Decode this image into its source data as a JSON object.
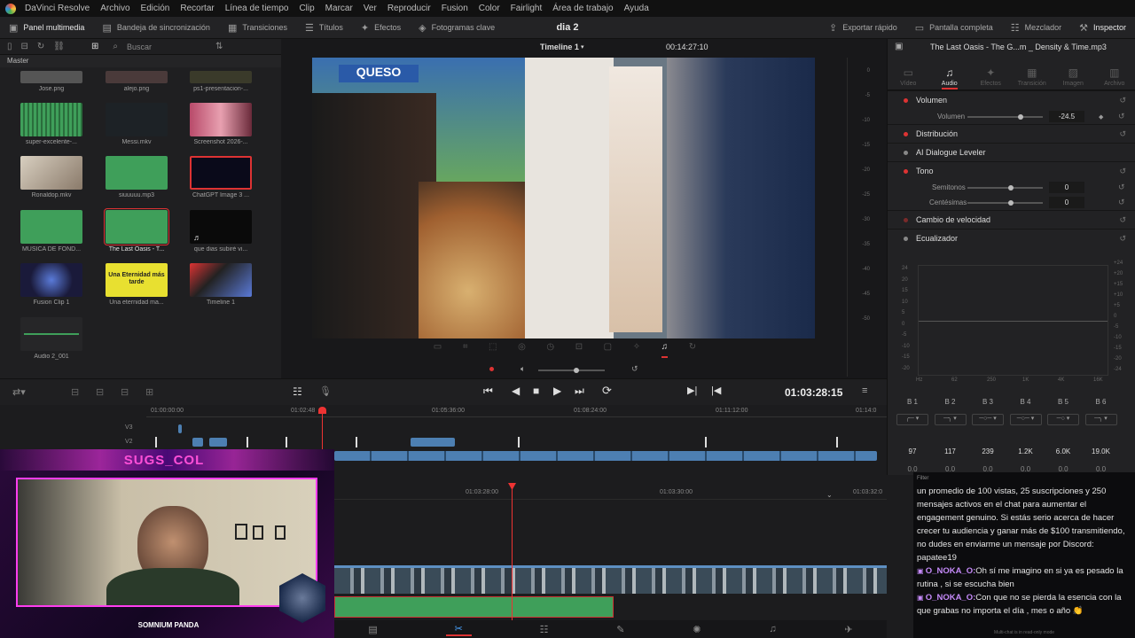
{
  "menubar": {
    "app": "DaVinci Resolve",
    "items": [
      "Archivo",
      "Edición",
      "Recortar",
      "Línea de tiempo",
      "Clip",
      "Marcar",
      "Ver",
      "Reproducir",
      "Fusion",
      "Color",
      "Fairlight",
      "Área de trabajo",
      "Ayuda"
    ]
  },
  "toolbar": {
    "media_pool": "Panel multimedia",
    "sync_bin": "Bandeja de sincronización",
    "transitions": "Transiciones",
    "titles": "Títulos",
    "effects": "Efectos",
    "keyframes": "Fotogramas clave",
    "project_title": "dia 2",
    "quick_export": "Exportar rápido",
    "fullscreen": "Pantalla completa",
    "mixer": "Mezclador",
    "inspector": "Inspector"
  },
  "media_pool": {
    "search_placeholder": "Buscar",
    "bin": "Master",
    "clips": [
      {
        "name": "Jose.png"
      },
      {
        "name": "alejo.png"
      },
      {
        "name": "ps1-presentacion-..."
      },
      {
        "name": "super-excelente-..."
      },
      {
        "name": "Messi.mkv"
      },
      {
        "name": "Screenshot 2026-..."
      },
      {
        "name": "Ronaldop.mkv"
      },
      {
        "name": "siuuuuu.mp3"
      },
      {
        "name": "ChatGPT Image 3 ..."
      },
      {
        "name": "MUSICA DE FOND..."
      },
      {
        "name": "The Last Oasis - T..."
      },
      {
        "name": "que dias subiré vi..."
      },
      {
        "name": "Fusion Clip 1"
      },
      {
        "name": "Una eternidad ma..."
      },
      {
        "name": "Timeline 1"
      },
      {
        "name": "Audio 2_001"
      }
    ],
    "thumb_text_eternidad": "Una Eternidad más tarde"
  },
  "viewer": {
    "timeline_name": "Timeline 1",
    "duration": "00:14:27:10",
    "video_sign_text": "QUESO",
    "meter_ticks": [
      "0",
      "-5",
      "-10",
      "-15",
      "-20",
      "-25",
      "-30",
      "-35",
      "-40",
      "-45",
      "-50"
    ]
  },
  "transport": {
    "timecode": "01:03:28:15"
  },
  "timeline": {
    "ruler1": [
      "01:00:00:00",
      "01:02:48",
      "01:05:36:00",
      "01:08:24:00",
      "01:11:12:00",
      "01:14:0"
    ],
    "tracks": [
      "V3",
      "V2"
    ],
    "ruler2": [
      "01:03:28:00",
      "01:03:30:00",
      "01:03:32:0"
    ]
  },
  "inspector": {
    "clip_title": "The Last Oasis - The G...m _ Density & Time.mp3",
    "tabs": [
      "Vídeo",
      "Audio",
      "Efectos",
      "Transición",
      "Imagen",
      "Archivo"
    ],
    "active_tab": "Audio",
    "volume_section": "Volumen",
    "volume_label": "Volumen",
    "volume_value": "-24.5",
    "volume_level": 0.72,
    "distribution": "Distribución",
    "dialogue_leveler": "AI Dialogue Leveler",
    "pitch": "Tono",
    "semitones_label": "Semitonos",
    "semitones_value": "0",
    "cents_label": "Centésimas",
    "cents_value": "0",
    "speed_change": "Cambio de velocidad",
    "equalizer": "Ecualizador",
    "eq_left_ticks": [
      "-20",
      "-15",
      "-10",
      "-5",
      "0",
      "5",
      "10",
      "15",
      "20",
      "24"
    ],
    "eq_right_ticks": [
      "+24",
      "+20",
      "+15",
      "+10",
      "+5",
      "0",
      "-5",
      "-10",
      "-15",
      "-20",
      "-24"
    ],
    "eq_freq_ticks": [
      "Hz",
      "62",
      "250",
      "1K",
      "4K",
      "16K"
    ],
    "bands": [
      {
        "name": "B 1",
        "value": "97"
      },
      {
        "name": "B 2",
        "value": "117"
      },
      {
        "name": "B 3",
        "value": "239"
      },
      {
        "name": "B 4",
        "value": "1.2K"
      },
      {
        "name": "B 5",
        "value": "6.0K"
      },
      {
        "name": "B 6",
        "value": "19.0K"
      }
    ],
    "band_gain_value": "0.0"
  },
  "webcam": {
    "channel_name": "SUGS_COL",
    "bottom_label": "SOMNIUM PANDA"
  },
  "chat": {
    "filter_label": "Filter",
    "messages": [
      {
        "user": "",
        "text": "un promedio de 100 vistas, 25 suscripciones y 250 mensajes activos en el chat para aumentar el engagement genuino. Si estás serio acerca de hacer crecer tu audiencia y ganar más de $100 transmitiendo, no dudes en enviarme un mensaje por Discord: papatee19"
      },
      {
        "user": "O_NOKA_O:",
        "text": "Oh sí me imagino en si ya es pesado la rutina , si se escucha bien"
      },
      {
        "user": "O_NOKA_O:",
        "text": "Con que no se pierda la esencia con la que grabas no importa el día , mes o año 👏"
      }
    ],
    "footer": "Multi-chat is in read-only mode"
  },
  "colors": {
    "accent_red": "#dd3333",
    "clip_blue": "#4d7fb2",
    "audio_green": "#3f9f5a",
    "neon_pink": "#ff3df0"
  }
}
